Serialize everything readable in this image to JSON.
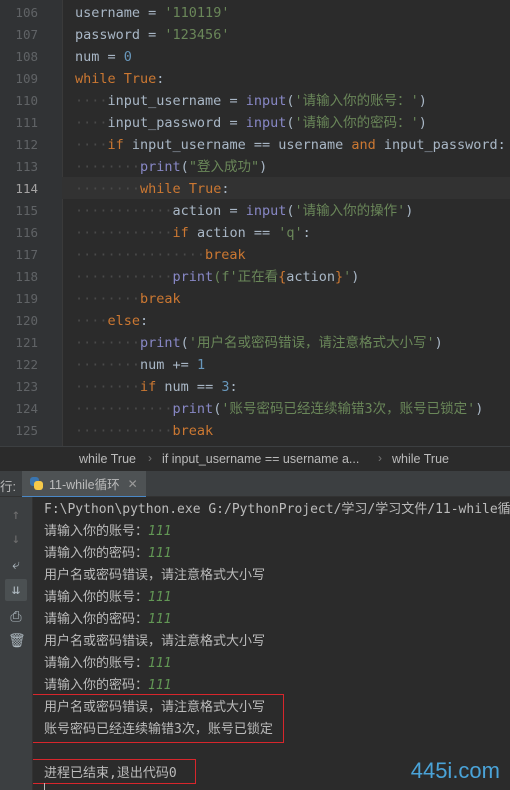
{
  "editor": {
    "line_numbers": [
      "106",
      "107",
      "108",
      "109",
      "110",
      "111",
      "112",
      "113",
      "114",
      "115",
      "116",
      "117",
      "118",
      "119",
      "120",
      "121",
      "122",
      "123",
      "124",
      "125"
    ],
    "current_line": "114",
    "code": {
      "l106": {
        "var": "username",
        "eq": " = ",
        "val": "'110119'"
      },
      "l107": {
        "var": "password",
        "eq": " = ",
        "val": "'123456'"
      },
      "l108": {
        "var": "num",
        "eq": " = ",
        "val": "0"
      },
      "l109": {
        "kw": "while",
        "sp": " ",
        "kw2": "True",
        "colon": ":"
      },
      "l110": {
        "var": "input_username",
        "eq": " = ",
        "fn": "input",
        "p1": "(",
        "s": "'请输入你的账号：'",
        "p2": ")"
      },
      "l111": {
        "var": "input_password",
        "eq": " = ",
        "fn": "input",
        "p1": "(",
        "s": "'请输入你的密码：'",
        "p2": ")"
      },
      "l112": {
        "kw": "if",
        "a": " input_username == username ",
        "kw2": "and",
        "b": " input_password:"
      },
      "l113": {
        "fn": "print",
        "p1": "(",
        "s": "\"登入成功\"",
        "p2": ")"
      },
      "l114": {
        "kw": "while",
        "sp": " ",
        "kw2": "True",
        "colon": ":"
      },
      "l115": {
        "var": "action",
        "eq": " = ",
        "fn": "input",
        "p1": "(",
        "s": "'请输入你的操作'",
        "p2": ")"
      },
      "l116": {
        "kw": "if",
        "a": " action == ",
        "s": "'q'",
        "colon": ":"
      },
      "l117": {
        "kw": "break"
      },
      "l118": {
        "fn": "print",
        "p1": "(f'",
        "s1": "正在看",
        "o": "{",
        "v": "action",
        "c": "}",
        "s2": "'",
        "p2": ")"
      },
      "l119": {
        "kw": "break"
      },
      "l120": {
        "kw": "else",
        "colon": ":"
      },
      "l121": {
        "fn": "print",
        "p1": "(",
        "s": "'用户名或密码错误，请注意格式大小写'",
        "p2": ")"
      },
      "l122": {
        "var": "num",
        "op": " += ",
        "n": "1"
      },
      "l123": {
        "kw": "if",
        "a": " num == ",
        "n": "3",
        "colon": ":"
      },
      "l124": {
        "fn": "print",
        "p1": "(",
        "s": "'账号密码已经连续输错3次，账号已锁定'",
        "p2": ")"
      },
      "l125": {
        "kw": "break"
      }
    }
  },
  "breadcrumb": [
    "while True",
    "if input_username == username a...",
    "while True"
  ],
  "run_panel": {
    "left_label": "行:",
    "tab_label": "11-while循环",
    "console_lines": [
      {
        "text": "F:\\Python\\python.exe G:/PythonProject/学习/学习文件/11-while循环"
      },
      {
        "text": "请输入你的账号：",
        "input": "111"
      },
      {
        "text": "请输入你的密码：",
        "input": "111"
      },
      {
        "text": "用户名或密码错误，请注意格式大小写"
      },
      {
        "text": "请输入你的账号：",
        "input": "111"
      },
      {
        "text": "请输入你的密码：",
        "input": "111"
      },
      {
        "text": "用户名或密码错误，请注意格式大小写"
      },
      {
        "text": "请输入你的账号：",
        "input": "111"
      },
      {
        "text": "请输入你的密码：",
        "input": "111"
      },
      {
        "text": "用户名或密码错误，请注意格式大小写"
      },
      {
        "text": "账号密码已经连续输错3次，账号已锁定"
      },
      {
        "text": ""
      },
      {
        "text": "进程已结束,退出代码0"
      }
    ]
  },
  "watermark": "445i.com",
  "colors": {
    "keyword": "#cc7832",
    "string": "#6a8759",
    "number": "#6897bb",
    "builtin": "#8888c6",
    "input_echo": "#629755",
    "highlight_box": "#d8262c"
  }
}
